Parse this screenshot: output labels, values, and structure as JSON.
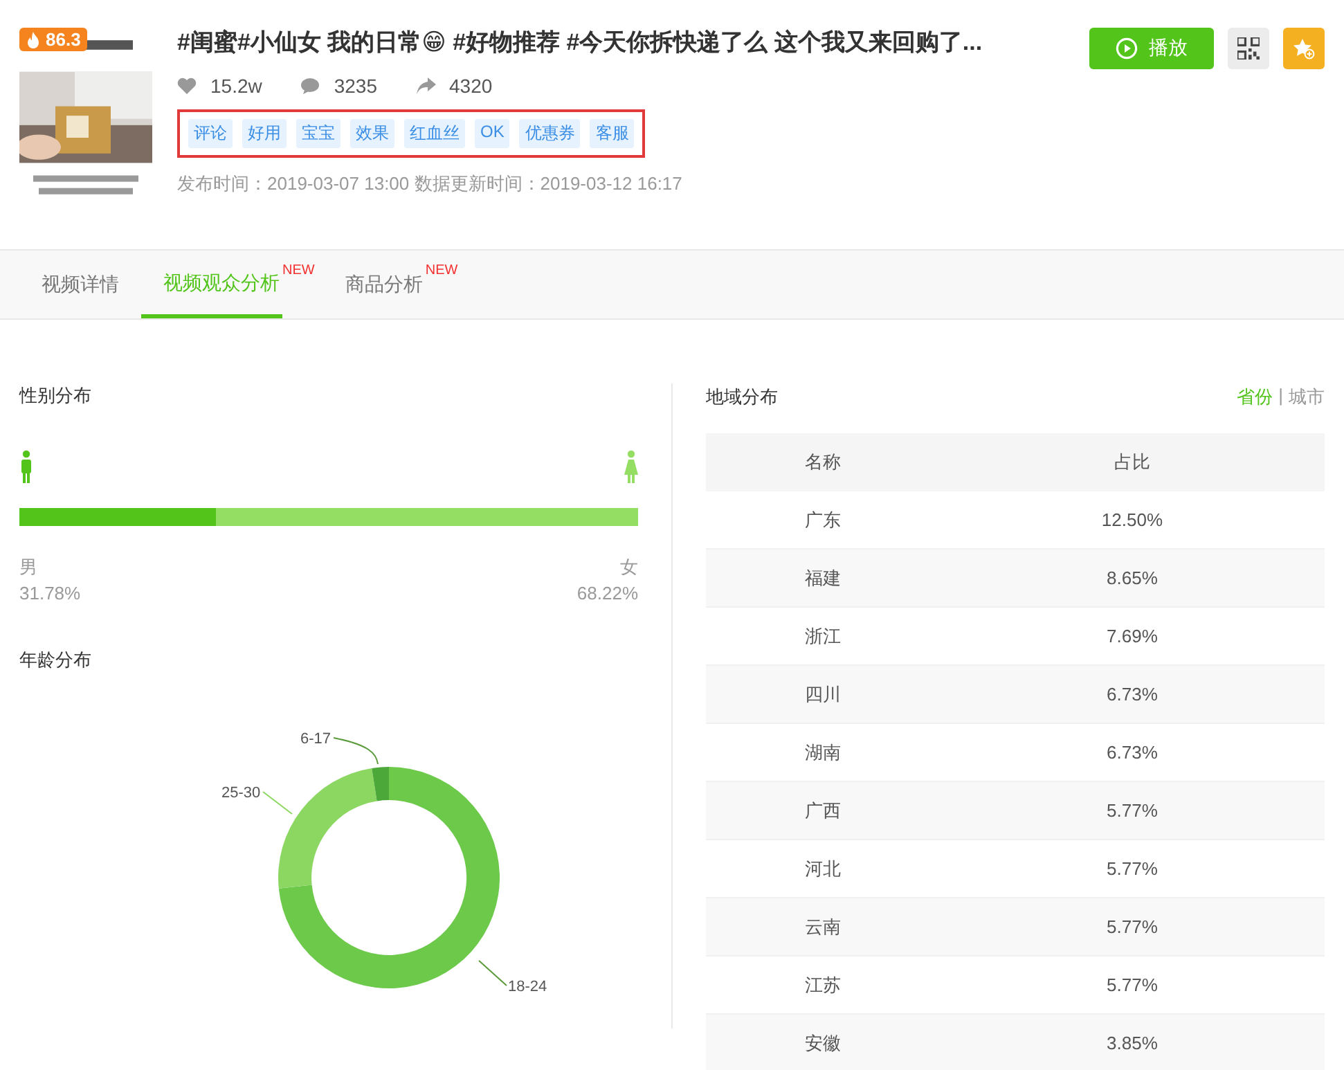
{
  "video": {
    "score": "86.3",
    "title": "#闺蜜#小仙女 我的日常😁 #好物推荐 #今天你拆快递了么 这个我又来回购了...",
    "stats": {
      "likes": "15.2w",
      "comments": "3235",
      "shares": "4320"
    },
    "tags": [
      "评论",
      "好用",
      "宝宝",
      "效果",
      "红血丝",
      "OK",
      "优惠券",
      "客服"
    ],
    "tags_highlighted": true,
    "published": "发布时间：2019-03-07 13:00 数据更新时间：2019-03-12 16:17",
    "play_button": "播放"
  },
  "tabs": [
    {
      "label": "视频详情",
      "selected": false
    },
    {
      "label": "视频观众分析",
      "selected": true,
      "badge": "NEW"
    },
    {
      "label": "商品分析",
      "selected": false,
      "badge": "NEW"
    }
  ],
  "gender": {
    "title": "性别分布",
    "male": {
      "label": "男",
      "value": "31.78%",
      "level": 0.3178
    },
    "female": {
      "label": "女",
      "value": "68.22%"
    }
  },
  "age": {
    "title": "年龄分布",
    "labels": [
      "6-17",
      "25-30",
      "18-24"
    ]
  },
  "region": {
    "title": "地域分布",
    "toggle": [
      {
        "label": "省份",
        "selected": true
      },
      {
        "label": "城市",
        "selected": false
      }
    ],
    "toggle_separator": "|",
    "columns": [
      "名称",
      "占比"
    ],
    "rows": [
      [
        "广东",
        "12.50%"
      ],
      [
        "福建",
        "8.65%"
      ],
      [
        "浙江",
        "7.69%"
      ],
      [
        "四川",
        "6.73%"
      ],
      [
        "湖南",
        "6.73%"
      ],
      [
        "广西",
        "5.77%"
      ],
      [
        "河北",
        "5.77%"
      ],
      [
        "云南",
        "5.77%"
      ],
      [
        "江苏",
        "5.77%"
      ],
      [
        "安徽",
        "3.85%"
      ]
    ]
  }
}
